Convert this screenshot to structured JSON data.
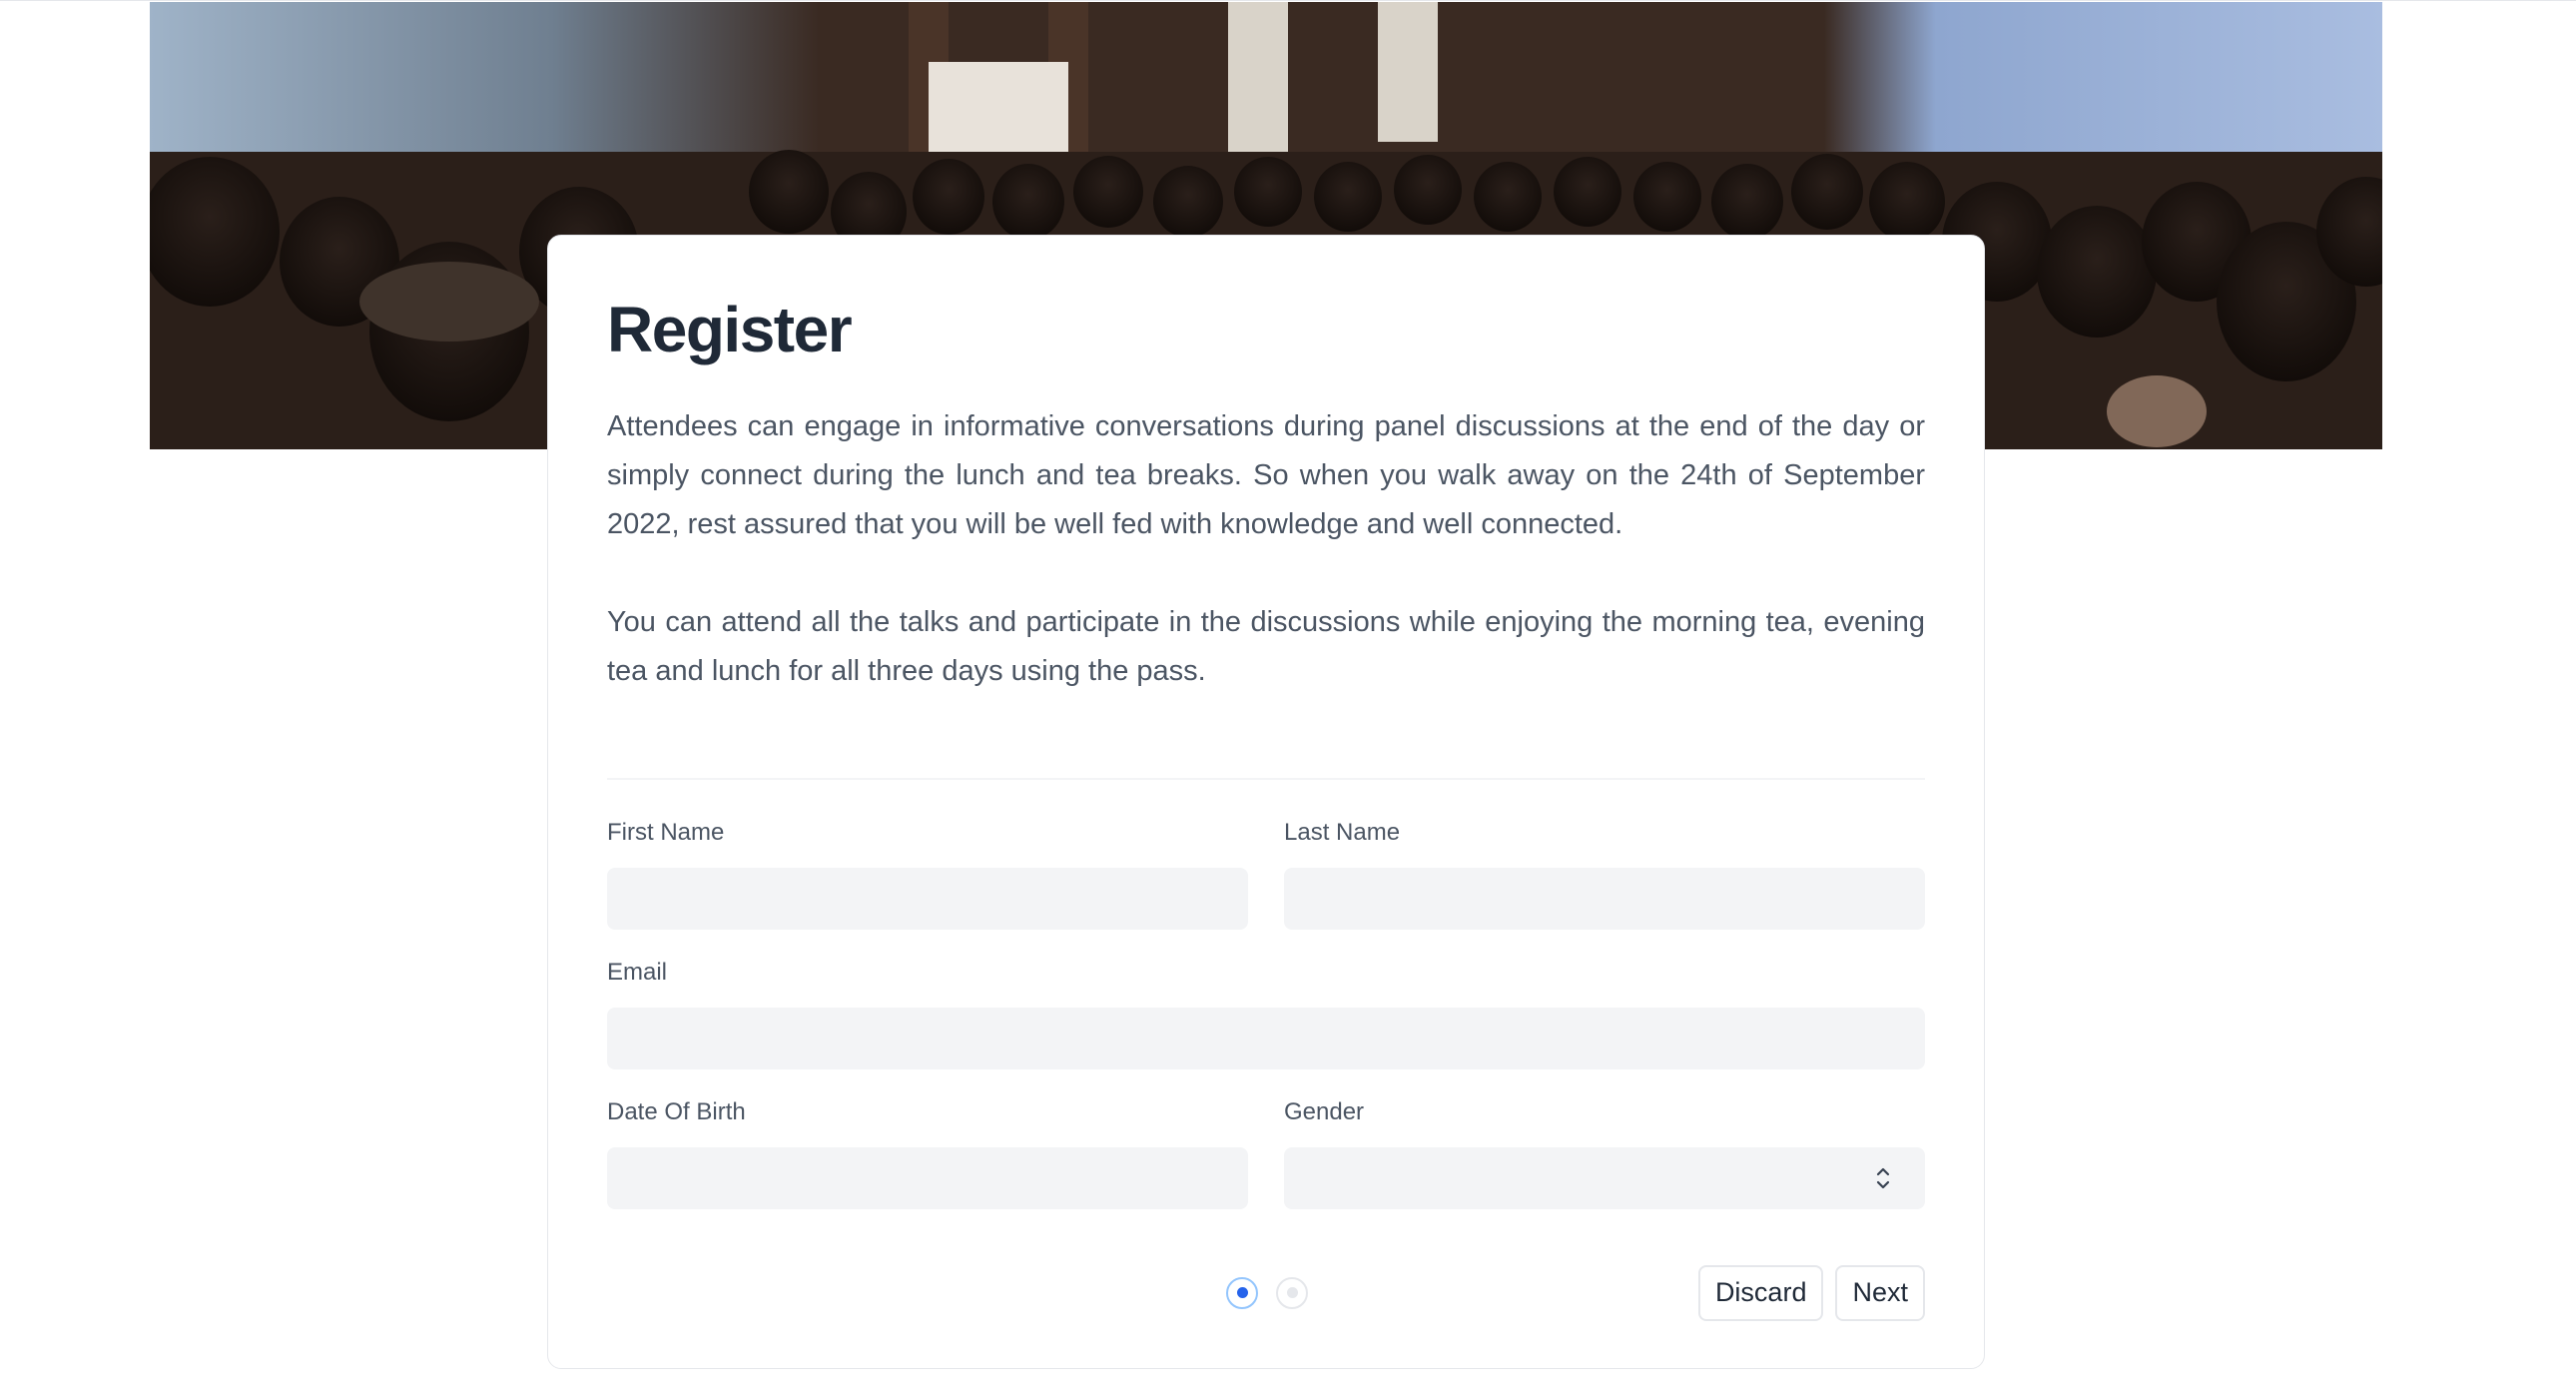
{
  "banner": {
    "image_alt": "conference-audience-photo"
  },
  "register": {
    "title": "Register",
    "paragraphs": [
      "Attendees can engage in informative conversations during panel discussions at the end of the day or simply connect during the lunch and tea breaks. So when you walk away on the 24th of September 2022, rest assured that you will be well fed with knowledge and well connected.",
      "You can attend all the talks and participate in the discussions while enjoying the morning tea, evening tea and lunch for all three days using the pass."
    ]
  },
  "form": {
    "first_name": {
      "label": "First Name",
      "value": ""
    },
    "last_name": {
      "label": "Last Name",
      "value": ""
    },
    "email": {
      "label": "Email",
      "value": ""
    },
    "dob": {
      "label": "Date Of Birth",
      "value": ""
    },
    "gender": {
      "label": "Gender",
      "value": ""
    }
  },
  "stepper": {
    "current_step": 1,
    "total_steps": 2
  },
  "actions": {
    "discard_label": "Discard",
    "next_label": "Next"
  },
  "colors": {
    "accent": "#2563eb",
    "input_bg": "#f3f4f6",
    "border": "#e5e7eb"
  }
}
